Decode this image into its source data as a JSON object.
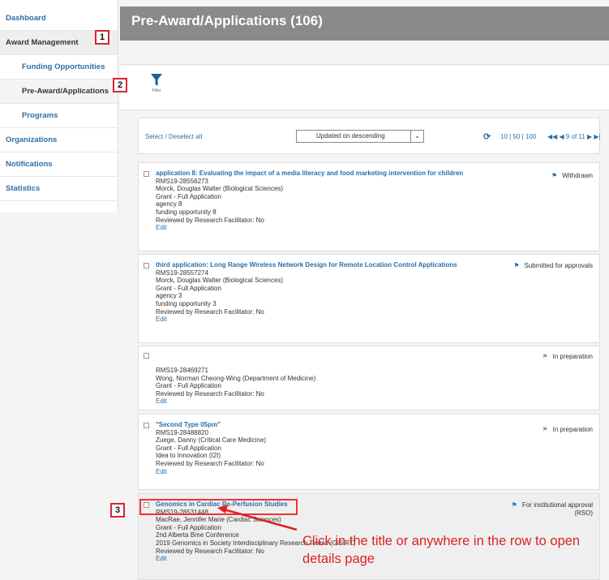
{
  "sidebar": {
    "items": [
      {
        "label": "Dashboard"
      },
      {
        "label": "Award Management"
      },
      {
        "label": "Funding Opportunities"
      },
      {
        "label": "Pre-Award/Applications"
      },
      {
        "label": "Programs"
      },
      {
        "label": "Organizations"
      },
      {
        "label": "Notifications"
      },
      {
        "label": "Statistics"
      }
    ]
  },
  "header": {
    "title": "Pre-Award/Applications (106)"
  },
  "filter": {
    "label": "Filter"
  },
  "toolbar": {
    "select_all": "Select / Deselect all",
    "sort_value": "Updated on descending",
    "page_sizes": "10 | 50 | 100",
    "pager": "◀◀ ◀ 9 of 11 ▶ ▶|"
  },
  "records": [
    {
      "title": "application 8: Evaluating the impact of a media literacy and food marketing intervention for children",
      "lines": [
        "RMS19-28556273",
        "Morck, Douglas Walter (Biological Sciences)",
        "Grant - Full Application",
        "agency 8",
        "funding opportunity 8",
        "Reviewed by Research Facilitator: No"
      ],
      "edit": "Edit",
      "status": "Withdrawn"
    },
    {
      "title": "third application: Long Range Wireless Network Design for Remote Location Control Applications",
      "lines": [
        "RMS19-28557274",
        "Morck, Douglas Walter (Biological Sciences)",
        "Grant - Full Application",
        "agency 3",
        "funding opportunity 3",
        "Reviewed by Research Facilitator: No"
      ],
      "edit": "Edit",
      "status": "Submitted for approvals"
    },
    {
      "title": "",
      "lines": [
        "RMS19-28469271",
        "Wong, Norman Cheong-Wing (Department of Medicine)",
        "Grant - Full Application",
        "Reviewed by Research Facilitator: No"
      ],
      "edit": "Edit",
      "status": "In preparation"
    },
    {
      "title": "\"Second Type 05pm\"",
      "lines": [
        "RMS19-28488820",
        "Zuege, Danny (Critical Care Medicine)",
        "Grant - Full Application",
        "Idea to Innovation (I2I)",
        "Reviewed by Research Facilitator: No"
      ],
      "edit": "Edit",
      "status": "In preparation"
    },
    {
      "title": "Genomics in Cardiac Re-Perfusion Studies",
      "lines": [
        "RMS19-28531448",
        "MacRae, Jennifer Marie (Cardiac Sciences)",
        "Grant - Full Application",
        "2nd Alberta Bme Conference",
        "2019 Genomics in Society Interdisciplinary Research Teams (GiSIRT)",
        "Reviewed by Research Facilitator: No"
      ],
      "edit": "Edit",
      "status": "For institutional approval",
      "status2": "(RSO)"
    }
  ],
  "annotations": {
    "badge1": "1",
    "badge2": "2",
    "badge3": "3",
    "callout": "Click in the title or anywhere in the row to open details page"
  },
  "colors": {
    "accent": "#2a6fa8",
    "annotation": "#e33333",
    "header": "#8a8a8a"
  },
  "icons": [
    "funnel-icon",
    "refresh-icon",
    "flag-icon",
    "chevron-down-icon"
  ]
}
